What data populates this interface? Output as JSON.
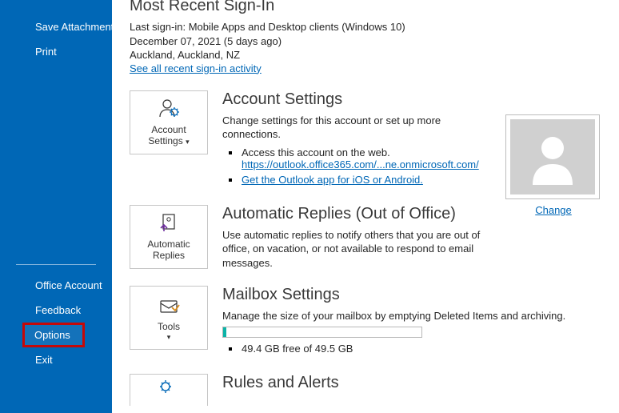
{
  "sidebar": {
    "saveAttachments": "Save Attachments",
    "print": "Print",
    "officeAccount": "Office Account",
    "feedback": "Feedback",
    "options": "Options",
    "exit": "Exit"
  },
  "signin": {
    "heading": "Most Recent Sign-In",
    "line1": "Last sign-in: Mobile Apps and Desktop clients (Windows 10)",
    "line2": "December 07, 2021 (5 days ago)",
    "line3": "Auckland, Auckland, NZ",
    "link": "See all recent sign-in activity"
  },
  "accountSettings": {
    "tile_line1": "Account",
    "tile_line2": "Settings",
    "heading": "Account Settings",
    "desc": "Change settings for this account or set up more connections.",
    "bullet1_label": "Access this account on the web.",
    "bullet1_link": "https://outlook.office365.com/...ne.onmicrosoft.com/",
    "bullet2_link": "Get the Outlook app for iOS or Android."
  },
  "avatar": {
    "change": "Change"
  },
  "autoReplies": {
    "tile_line1": "Automatic",
    "tile_line2": "Replies",
    "heading": "Automatic Replies (Out of Office)",
    "desc": "Use automatic replies to notify others that you are out of office, on vacation, or not available to respond to email messages."
  },
  "mailbox": {
    "tile_line1": "Tools",
    "heading": "Mailbox Settings",
    "desc": "Manage the size of your mailbox by emptying Deleted Items and archiving.",
    "storage": "49.4 GB free of 49.5 GB"
  },
  "rules": {
    "heading": "Rules and Alerts"
  }
}
